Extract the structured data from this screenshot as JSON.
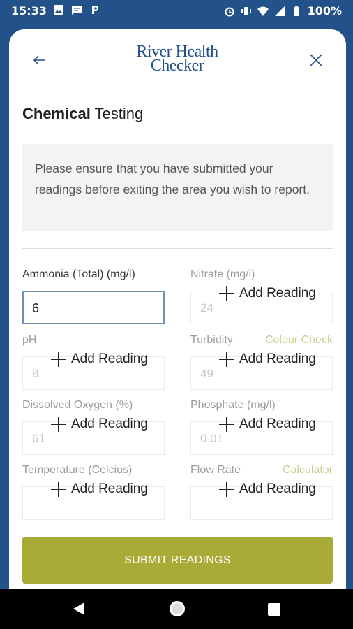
{
  "status_bar": {
    "time": "15:33",
    "battery": "100%"
  },
  "header": {
    "logo_line1": "River Health",
    "logo_line2": "Checker"
  },
  "page": {
    "title_bold": "Chemical",
    "title_rest": "Testing"
  },
  "notice": "Please ensure that you have submitted your readings before exiting the area you wish to report.",
  "add_reading_label": "Add Reading",
  "fields": {
    "ammonia": {
      "label": "Ammonia (Total) (mg/l)",
      "value": "6"
    },
    "nitrate": {
      "label": "Nitrate (mg/l)",
      "placeholder": "24"
    },
    "ph": {
      "label": "pH",
      "placeholder": "8"
    },
    "turbidity": {
      "label": "Turbidity",
      "link": "Colour Check",
      "placeholder": "49"
    },
    "dissolved_oxygen": {
      "label": "Dissolved Oxygen (%)",
      "placeholder": "61"
    },
    "phosphate": {
      "label": "Phosphate (mg/l)",
      "placeholder": "0.01"
    },
    "temperature": {
      "label": "Temperature (Celcius)",
      "placeholder": ""
    },
    "flow_rate": {
      "label": "Flow Rate",
      "link": "Calculator",
      "placeholder": ""
    }
  },
  "submit_label": "SUBMIT READINGS",
  "colors": {
    "brand_blue": "#23528a",
    "accent_olive": "#a9ab37",
    "link_muted": "#c9d08f"
  }
}
